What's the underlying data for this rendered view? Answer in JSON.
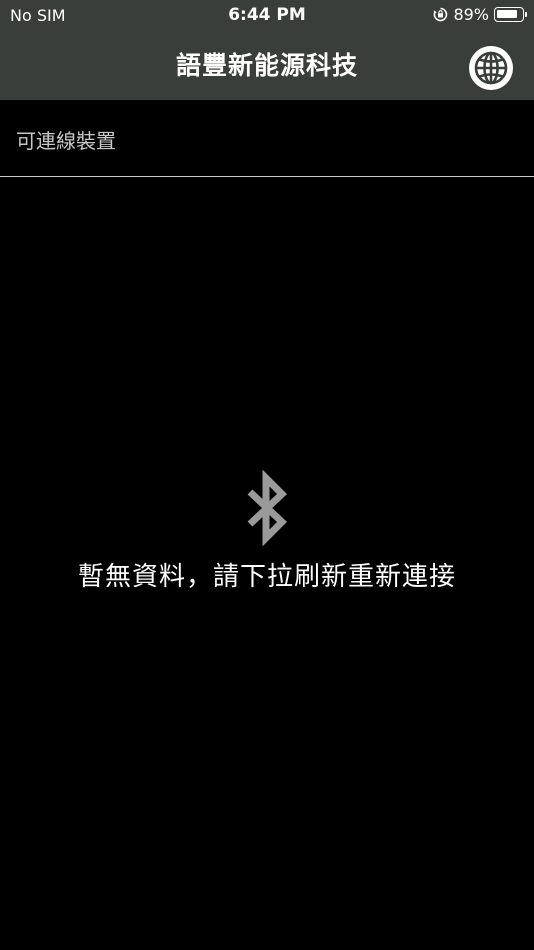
{
  "status_bar": {
    "carrier": "No SIM",
    "time": "6:44 PM",
    "battery_percent": "89%",
    "battery_level": 0.89,
    "orientation_lock_icon": "orientation-lock-icon"
  },
  "nav": {
    "title": "語豐新能源科技",
    "right_icon": "globe-icon"
  },
  "section": {
    "label": "可連線裝置"
  },
  "empty_state": {
    "icon": "bluetooth-icon",
    "message": "暫無資料，請下拉刷新重新連接"
  },
  "colors": {
    "nav_background": "#3a3e3a",
    "page_background": "#000000",
    "icon_gray": "#9a9a9a",
    "label_gray": "#c7c7c7"
  }
}
